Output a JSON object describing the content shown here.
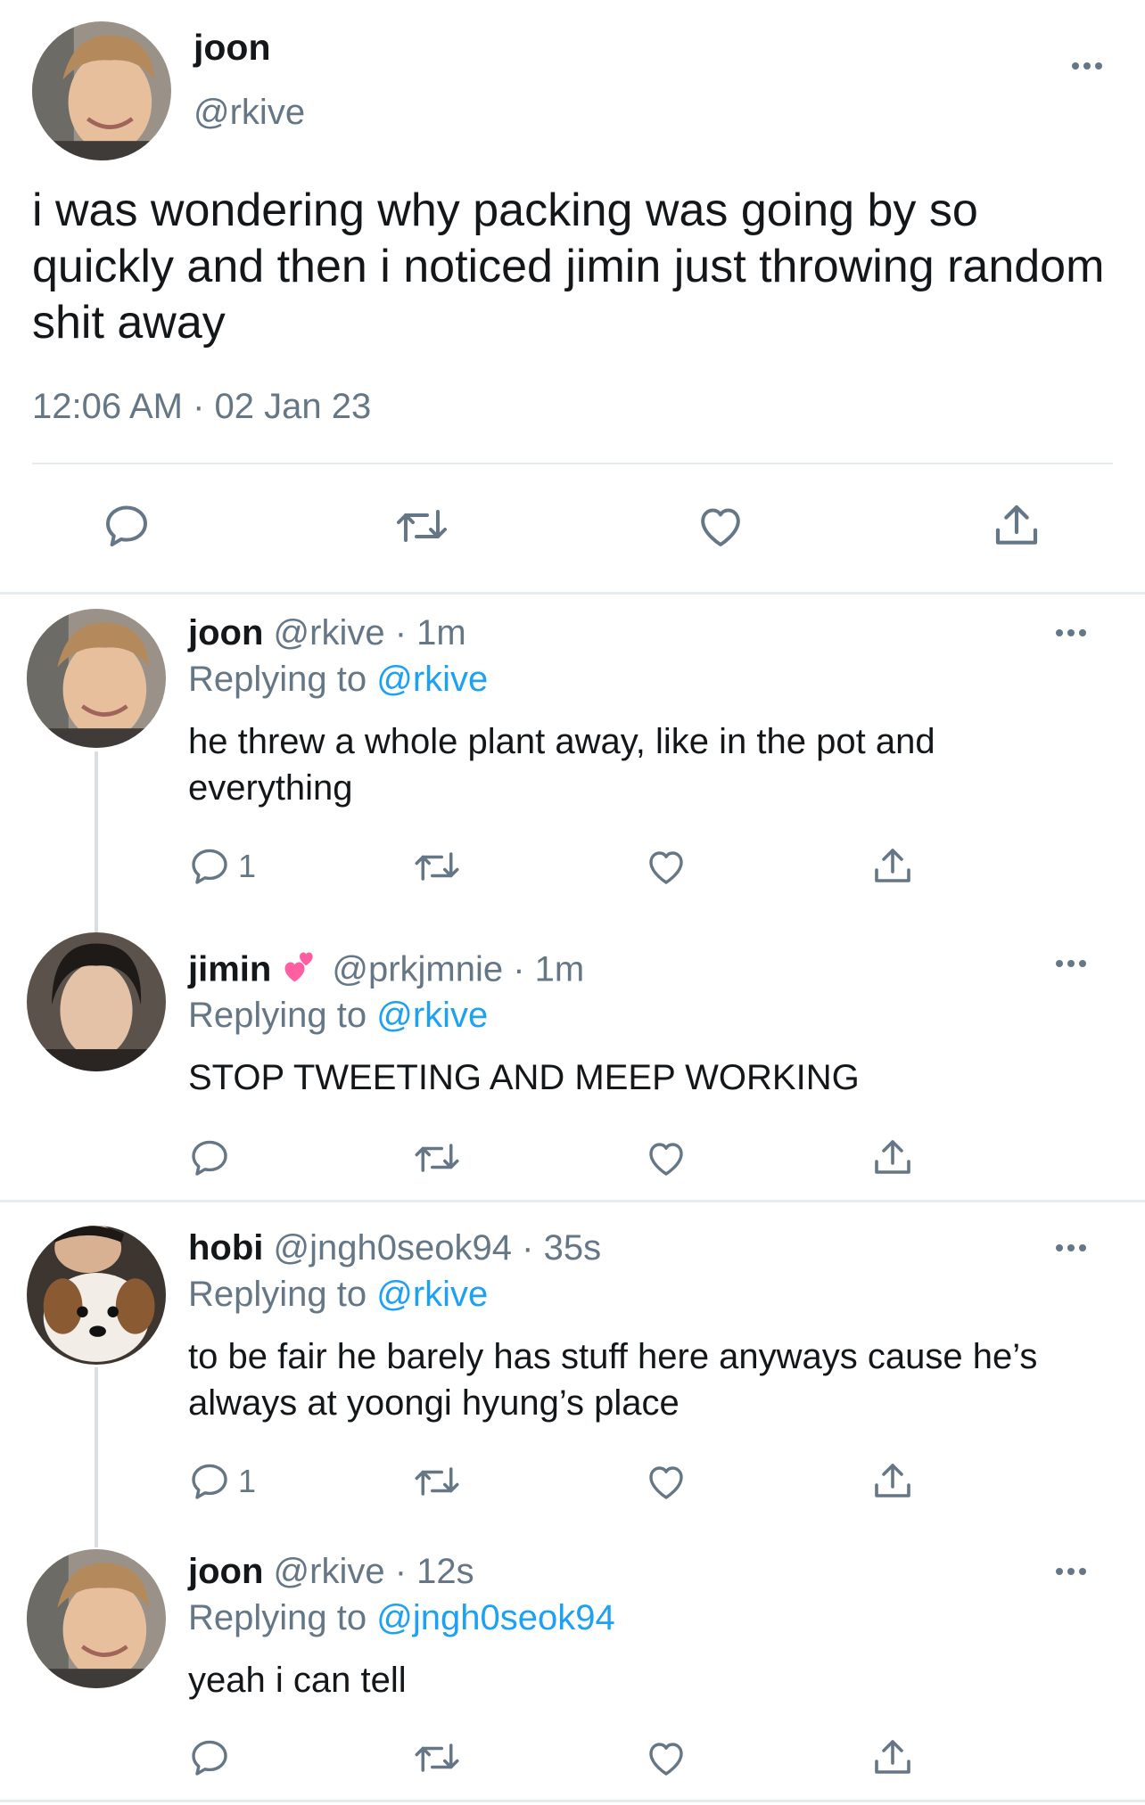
{
  "main_tweet": {
    "name": "joon",
    "handle": "@rkive",
    "text": "i was wondering why packing was going by so quickly and then i noticed jimin just throwing random shit away",
    "timestamp": "12:06 AM · 02 Jan 23"
  },
  "replies": [
    {
      "name": "joon",
      "handle": "@rkive",
      "time": "· 1m",
      "replying_prefix": "Replying to ",
      "replying_to": "@rkive",
      "text": "he threw a whole plant away, like in the pot and everything",
      "reply_count": "1"
    },
    {
      "name": "jimin",
      "handle": "@prkjmnie",
      "time": "· 1m",
      "replying_prefix": "Replying to ",
      "replying_to": "@rkive",
      "text": "STOP TWEETING AND MEEP WORKING",
      "reply_count": ""
    },
    {
      "name": "hobi",
      "handle": "@jngh0seok94",
      "time": "· 35s",
      "replying_prefix": "Replying to ",
      "replying_to": "@rkive",
      "text": "to be fair he barely has stuff here anyways cause he’s always at yoongi hyung’s place",
      "reply_count": "1"
    },
    {
      "name": "joon",
      "handle": "@rkive",
      "time": "· 12s",
      "replying_prefix": "Replying to ",
      "replying_to": "@jngh0seok94",
      "text": "yeah i can tell",
      "reply_count": ""
    }
  ],
  "icons": {
    "reply": "speech-bubble-icon",
    "retweet": "retweet-icon",
    "like": "heart-icon",
    "share": "share-icon",
    "more": "more-dots-icon",
    "emoji": "two-hearts-emoji"
  },
  "colors": {
    "text": "#14171a",
    "secondary": "#657786",
    "link": "#1da1f2",
    "divider": "#e6ecf0"
  }
}
